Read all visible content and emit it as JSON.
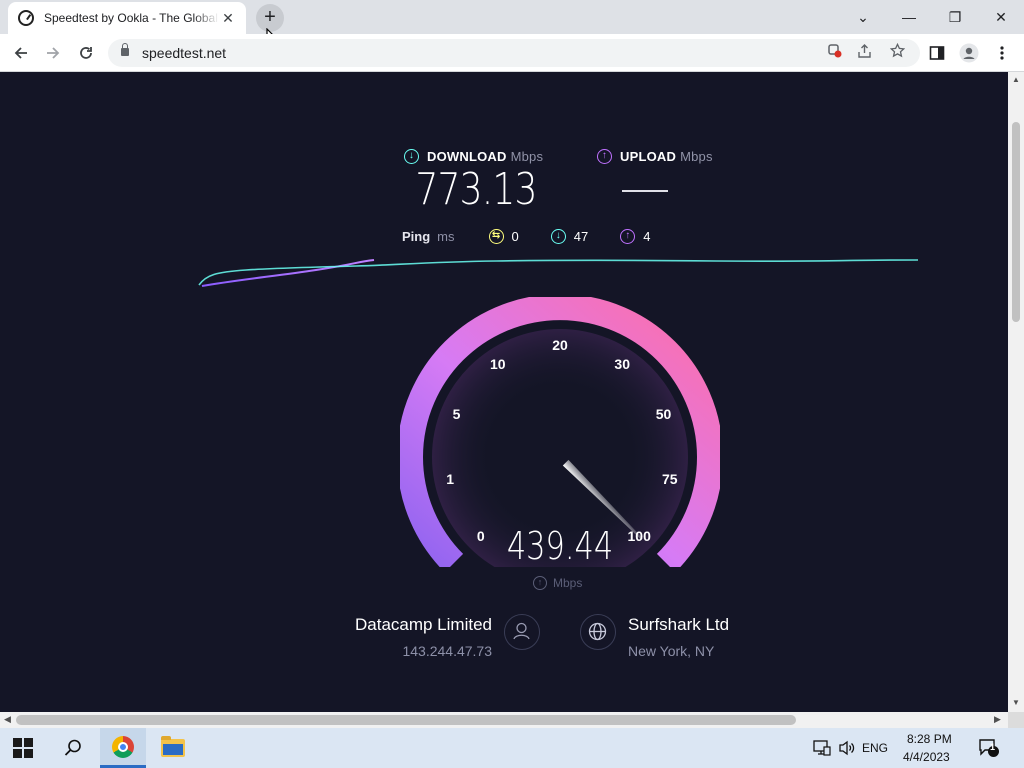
{
  "browser": {
    "tab_title": "Speedtest by Ookla - The Global Broadband Speed Test",
    "tab_close": "✕",
    "new_tab": "+",
    "url": "speedtest.net",
    "window_controls": {
      "tab_search": "⌄",
      "minimize": "—",
      "restore": "❐",
      "close": "✕"
    }
  },
  "speedtest": {
    "download": {
      "label": "DOWNLOAD",
      "unit": "Mbps",
      "value": "773.13"
    },
    "upload": {
      "label": "UPLOAD",
      "unit": "Mbps",
      "value": "—"
    },
    "ping": {
      "label": "Ping",
      "unit": "ms",
      "idle": "0",
      "download": "47",
      "upload": "4"
    },
    "gauge": {
      "scale_labels": [
        "0",
        "1",
        "5",
        "10",
        "20",
        "30",
        "50",
        "75",
        "100"
      ],
      "current_speed": "439.44",
      "unit": "Mbps",
      "needle_value": 100
    },
    "isp": {
      "name": "Datacamp Limited",
      "ip": "143.244.47.73"
    },
    "server": {
      "name": "Surfshark Ltd",
      "location": "New York, NY"
    }
  },
  "taskbar": {
    "language": "ENG",
    "time": "8:28 PM",
    "date": "4/4/2023",
    "notification_count": "1"
  },
  "colors": {
    "page_bg": "#141526",
    "download_accent": "#6afff3",
    "upload_accent": "#bf71ff",
    "gauge_start": "#9b6cf0",
    "gauge_end": "#ff6fa8"
  }
}
